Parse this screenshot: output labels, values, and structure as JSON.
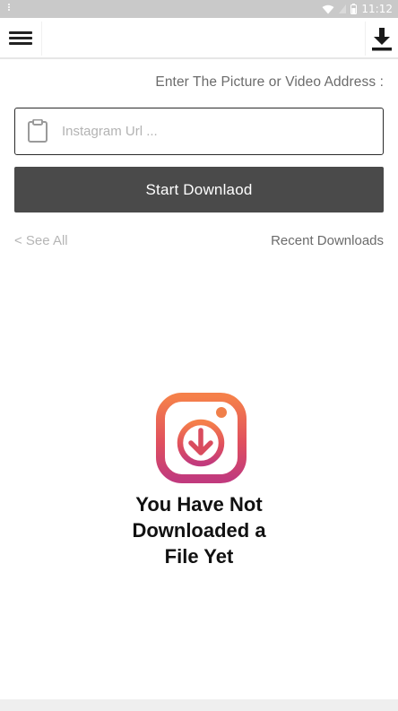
{
  "status_bar": {
    "time": "11:12"
  },
  "toolbar": {
    "menu_icon": "hamburger-menu-icon",
    "download_icon": "download-icon"
  },
  "form": {
    "prompt": "Enter The Picture or Video Address :",
    "url_placeholder": "Instagram Url ...",
    "url_value": "",
    "start_button": "Start Downlaod"
  },
  "history": {
    "see_all": "< See All",
    "recent": "Recent Downloads"
  },
  "empty_state": {
    "line1": "You Have Not",
    "line2": "Downloaded a",
    "line3": "File Yet",
    "icon": "instagram-download-icon"
  },
  "colors": {
    "button_bg": "#4a4a4a",
    "gradient_start": "#f58529",
    "gradient_end": "#c13584"
  }
}
